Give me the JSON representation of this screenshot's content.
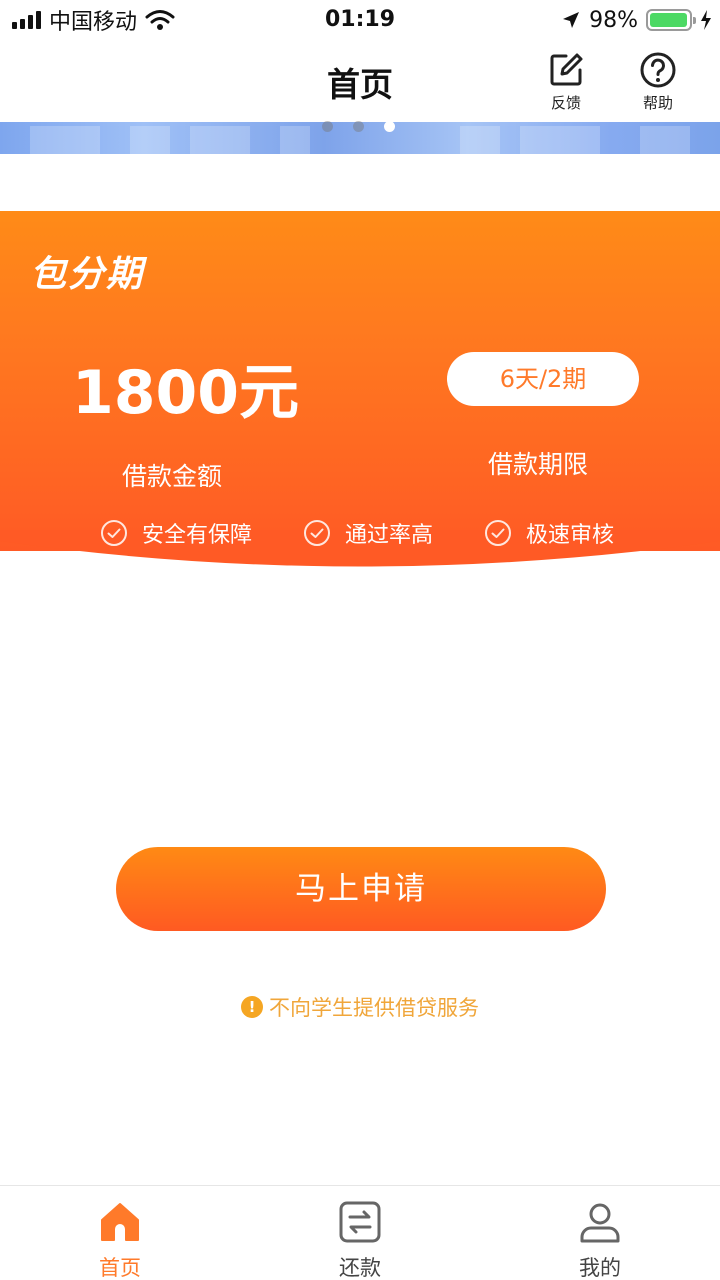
{
  "status_bar": {
    "carrier": "中国移动",
    "time": "01:19",
    "battery_percent": "98%",
    "battery_level": 0.98,
    "battery_color": "#4cd964"
  },
  "nav": {
    "title": "首页",
    "feedback_label": "反馈",
    "feedback_icon": "edit-icon",
    "help_label": "帮助",
    "help_icon": "question-circle-icon"
  },
  "banner": {
    "slide_count": 3,
    "active_slide": 3
  },
  "loan_card": {
    "brand": "包分期",
    "amount": "1800元",
    "amount_label": "借款金额",
    "term": "6天/2期",
    "term_label": "借款期限",
    "features": [
      "安全有保障",
      "通过率高",
      "极速审核"
    ],
    "gradient_top": "#ff8b17",
    "gradient_bottom": "#ff5a25"
  },
  "apply_button": {
    "label": "马上申请"
  },
  "notice": {
    "text": "不向学生提供借贷服务",
    "color": "#f0a63a"
  },
  "tab_bar": {
    "active_color": "#ff7a2a",
    "items": [
      {
        "label": "首页",
        "icon": "home-icon",
        "active": true
      },
      {
        "label": "还款",
        "icon": "repay-icon",
        "active": false
      },
      {
        "label": "我的",
        "icon": "user-icon",
        "active": false
      }
    ]
  }
}
